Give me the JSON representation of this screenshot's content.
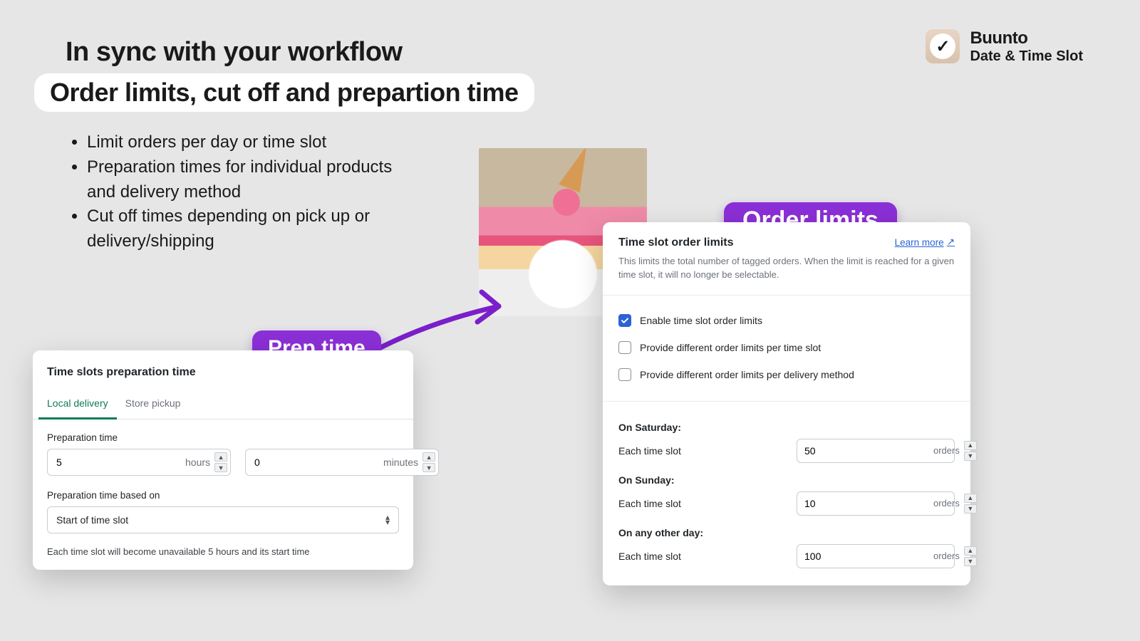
{
  "brand": {
    "name": "Buunto",
    "subtitle": "Date & Time Slot"
  },
  "hero": {
    "line1": "In sync with your workflow",
    "line2": "Order limits, cut off and prepartion time"
  },
  "bullets": [
    "Limit orders per day or time slot",
    "Preparation times for individual products and delivery method",
    "Cut off times depending on pick up or delivery/shipping"
  ],
  "callouts": {
    "prep": "Prep time",
    "order": "Order limits"
  },
  "prep_card": {
    "title": "Time slots preparation time",
    "tabs": {
      "local": "Local delivery",
      "pickup": "Store pickup"
    },
    "label_time": "Preparation time",
    "hours_value": "5",
    "hours_unit": "hours",
    "minutes_value": "0",
    "minutes_unit": "minutes",
    "label_based": "Preparation time based on",
    "select_value": "Start of time slot",
    "hint": "Each time slot will become unavailable 5 hours and its start time"
  },
  "order_card": {
    "title": "Time slot order limits",
    "learn": "Learn more",
    "desc": "This limits the total number of tagged orders. When the limit is reached for a given time slot, it will no longer be selectable.",
    "chk_enable": "Enable time slot order limits",
    "chk_per_slot": "Provide different order limits per time slot",
    "chk_per_method": "Provide different order limits per delivery method",
    "each": "Each time slot",
    "unit": "orders",
    "days": {
      "sat_title": "On Saturday:",
      "sat_value": "50",
      "sun_title": "On Sunday:",
      "sun_value": "10",
      "other_title": "On any other day:",
      "other_value": "100"
    }
  }
}
